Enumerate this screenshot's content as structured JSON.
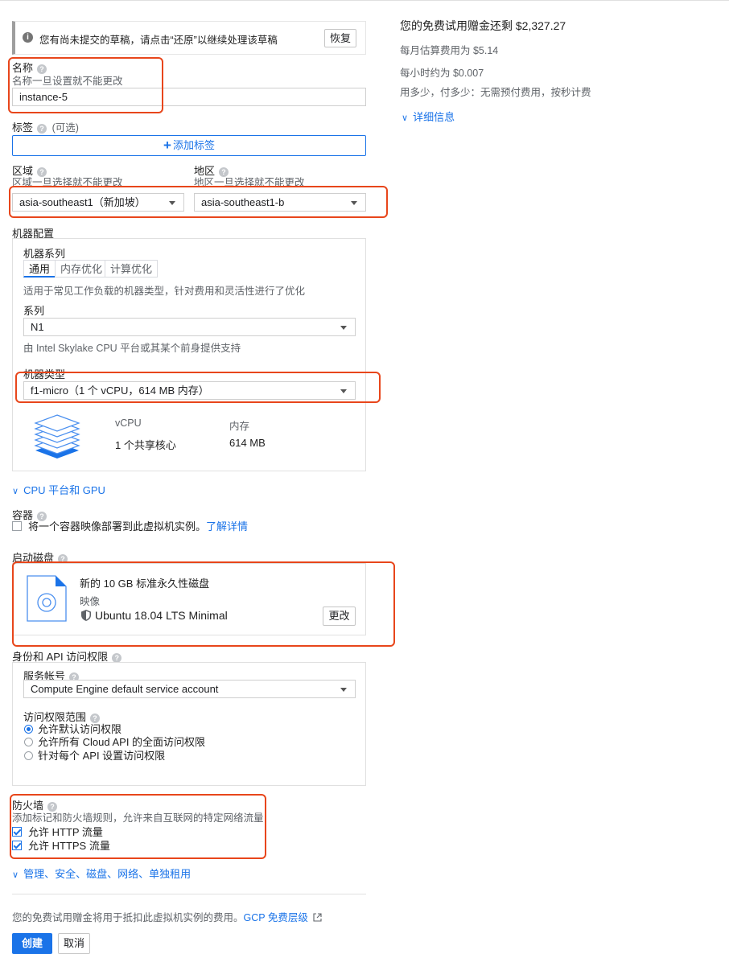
{
  "draft": {
    "message": "您有尚未提交的草稿，请点击“还原”以继续处理该草稿",
    "restore_label": "恢复"
  },
  "name": {
    "label": "名称",
    "hint": "名称一旦设置就不能更改",
    "value": "instance-5"
  },
  "labels": {
    "label": "标签",
    "optional": "(可选)",
    "add_label": "添加标签"
  },
  "region": {
    "label": "区域",
    "hint": "区域一旦选择就不能更改",
    "value": "asia-southeast1（新加坡）"
  },
  "zone": {
    "label": "地区",
    "hint": "地区一旦选择就不能更改",
    "value": "asia-southeast1-b"
  },
  "machine": {
    "section_label": "机器配置",
    "family_label": "机器系列",
    "tabs": [
      "通用",
      "内存优化",
      "计算优化"
    ],
    "active_tab": "通用",
    "family_hint": "适用于常见工作负载的机器类型，针对费用和灵活性进行了优化",
    "series_label": "系列",
    "series_value": "N1",
    "series_hint": "由 Intel Skylake CPU 平台或其某个前身提供支持",
    "type_label": "机器类型",
    "type_value": "f1-micro（1 个 vCPU，614 MB 内存）",
    "vcpu_header": "vCPU",
    "vcpu_value": "1 个共享核心",
    "mem_header": "内存",
    "mem_value": "614 MB"
  },
  "cpu_gpu_link": "CPU 平台和 GPU",
  "container": {
    "label": "容器",
    "checkbox_text": "将一个容器映像部署到此虚拟机实例。",
    "learn_more": "了解详情"
  },
  "boot_disk": {
    "label": "启动磁盘",
    "title": "新的 10 GB 标准永久性磁盘",
    "image_label": "映像",
    "image_value": "Ubuntu 18.04 LTS Minimal",
    "change_label": "更改"
  },
  "identity": {
    "label": "身份和 API 访问权限",
    "sa_label": "服务帐号",
    "sa_value": "Compute Engine default service account",
    "scope_label": "访问权限范围",
    "scopes": [
      "允许默认访问权限",
      "允许所有 Cloud API 的全面访问权限",
      "针对每个 API 设置访问权限"
    ],
    "selected_scope": "允许默认访问权限"
  },
  "firewall": {
    "label": "防火墙",
    "hint": "添加标记和防火墙规则，允许来自互联网的特定网络流量",
    "http": "允许 HTTP 流量",
    "https": "允许 HTTPS 流量",
    "http_checked": true,
    "https_checked": true
  },
  "advanced_link": "管理、安全、磁盘、网络、单独租用",
  "footer": {
    "note": "您的免费试用赠金将用于抵扣此虚拟机实例的费用。",
    "tier_link": "GCP 免费层级",
    "create": "创建",
    "cancel": "取消"
  },
  "pricing": {
    "title": "您的免费试用赠金还剩 $2,327.27",
    "monthly": "每月估算费用为 $5.14",
    "hourly": "每小时约为 $0.007",
    "pay_note": "用多少，付多少：无需预付费用，按秒计费",
    "details": "详细信息"
  },
  "colors": {
    "accent": "#1a73e8",
    "highlight": "#e8461b",
    "primary_button": "#1a73e8"
  }
}
